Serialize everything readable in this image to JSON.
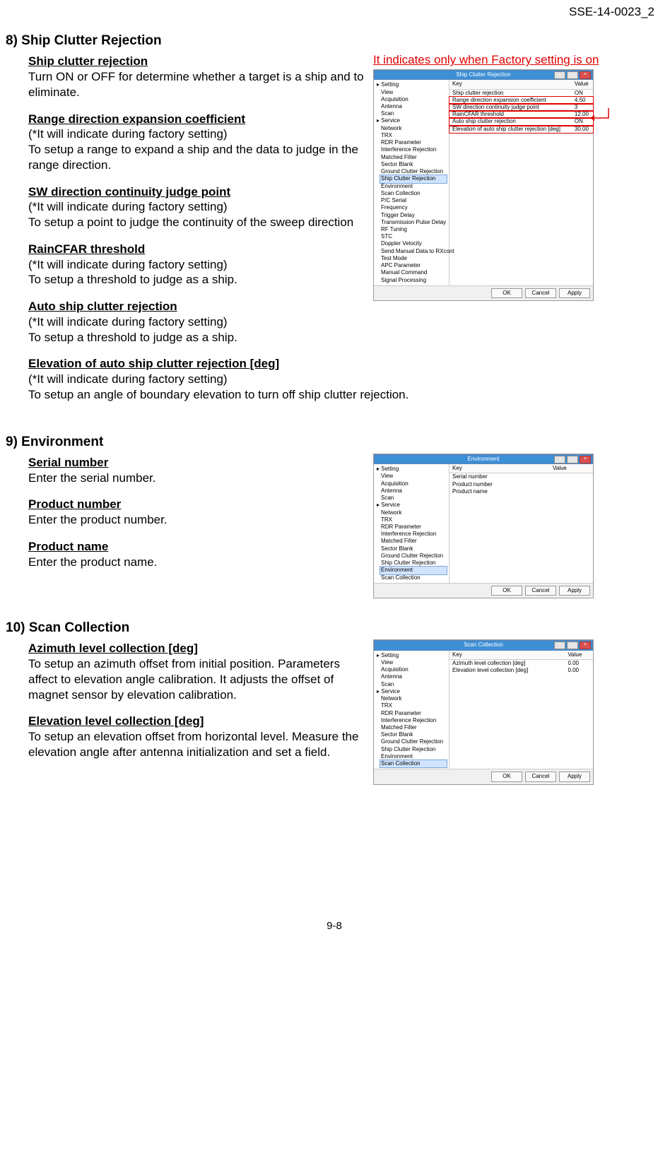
{
  "doc_id": "SSE-14-0023_2",
  "page_number": "9-8",
  "s8": {
    "heading": "8) Ship Clutter Rejection",
    "red_note": "It indicates only when Factory setting is on",
    "items": [
      {
        "title": "Ship clutter rejection",
        "body": "Turn ON or OFF for determine whether a target is a ship and to eliminate."
      },
      {
        "title": "Range direction expansion coefficient",
        "note": "(*It will indicate during factory setting)",
        "body": "To setup a range to expand a ship and the data to judge in the range direction."
      },
      {
        "title": "SW direction continuity judge point",
        "note": "(*It will indicate during factory setting)",
        "body": "To setup a point to judge the continuity of the sweep direction"
      },
      {
        "title": "RainCFAR threshold",
        "note": "(*It will indicate during factory setting)",
        "body": "To setup a threshold to judge as a ship."
      },
      {
        "title": "Auto ship clutter rejection",
        "note": "(*It will indicate during factory setting)",
        "body": "To setup a threshold to judge as a ship."
      },
      {
        "title": "Elevation of auto ship clutter rejection [deg]",
        "note": "(*It will indicate during factory setting)",
        "body": "To setup an angle of boundary elevation to turn off ship clutter rejection."
      }
    ],
    "dialog": {
      "title": "Ship Clutter Rejection",
      "key_hdr": "Key",
      "val_hdr": "Value",
      "rows": [
        {
          "k": "Ship clutter rejection",
          "v": "ON"
        },
        {
          "k": "Range direction expansion coefficient",
          "v": "4.50",
          "red": true
        },
        {
          "k": "SW direction continuity judge point",
          "v": "3",
          "red": true
        },
        {
          "k": "RainCFAR threshold",
          "v": "12.00",
          "red": true
        },
        {
          "k": "Auto ship clutter rejection",
          "v": "ON",
          "red": true
        },
        {
          "k": "Elevation of auto ship clutter rejection [deg]",
          "v": "30.00",
          "red": true
        }
      ],
      "tree": [
        "Setting",
        " View",
        " Acquisition",
        " Antenna",
        " Scan",
        "Service",
        " Network",
        " TRX",
        " RDR Parameter",
        " Interference Rejection",
        " Matched Filter",
        " Sector Blank",
        " Ground Clutter Rejection",
        " Ship Clutter Rejection",
        " Environment",
        " Scan Collection",
        " P/C Serial",
        " Frequency",
        " Trigger Delay",
        " Transmission Pulse Delay",
        " RF Tuning",
        " STC",
        " Doppler Velocity",
        " Send Manual Data to RXcont",
        " Test Mode",
        " APC Parameter",
        " Manual Command",
        " Signal Processing"
      ],
      "selected": "Ship Clutter Rejection",
      "buttons": [
        "OK",
        "Cancel",
        "Apply"
      ]
    }
  },
  "s9": {
    "heading": "9) Environment",
    "items": [
      {
        "title": "Serial number",
        "body": "Enter the serial number."
      },
      {
        "title": "Product number",
        "body": "Enter the product number."
      },
      {
        "title": "Product name",
        "body": "Enter the product name."
      }
    ],
    "dialog": {
      "title": "Environment",
      "key_hdr": "Key",
      "val_hdr": "Value",
      "rows": [
        {
          "k": "Serial number",
          "v": ""
        },
        {
          "k": "Product number",
          "v": ""
        },
        {
          "k": "Product name",
          "v": ""
        }
      ],
      "tree": [
        "Setting",
        " View",
        " Acquisition",
        " Antenna",
        " Scan",
        "Service",
        " Network",
        " TRX",
        " RDR Parameter",
        " Interference Rejection",
        " Matched Filter",
        " Sector Blank",
        " Ground Clutter Rejection",
        " Ship Clutter Rejection",
        " Environment",
        " Scan Collection"
      ],
      "selected": "Environment",
      "buttons": [
        "OK",
        "Cancel",
        "Apply"
      ]
    }
  },
  "s10": {
    "heading": "10) Scan Collection",
    "items": [
      {
        "title": "Azimuth level collection [deg]",
        "body": "To setup an azimuth offset from initial position. Parameters affect to elevation angle calibration. It adjusts the offset of magnet sensor by elevation calibration."
      },
      {
        "title": "Elevation level collection [deg]",
        "body": "To setup an elevation offset from horizontal level. Measure the elevation angle after antenna initialization and set a field."
      }
    ],
    "dialog": {
      "title": "Scan Collection",
      "key_hdr": "Key",
      "val_hdr": "Value",
      "rows": [
        {
          "k": "Azimuth level collection [deg]",
          "v": "0.00"
        },
        {
          "k": "Elevation level collection [deg]",
          "v": "0.00"
        }
      ],
      "tree": [
        "Setting",
        " View",
        " Acquisition",
        " Antenna",
        " Scan",
        "Service",
        " Network",
        " TRX",
        " RDR Parameter",
        " Interference Rejection",
        " Matched Filter",
        " Sector Blank",
        " Ground Clutter Rejection",
        " Ship Clutter Rejection",
        " Environment",
        " Scan Collection"
      ],
      "selected": "Scan Collection",
      "buttons": [
        "OK",
        "Cancel",
        "Apply"
      ]
    }
  }
}
